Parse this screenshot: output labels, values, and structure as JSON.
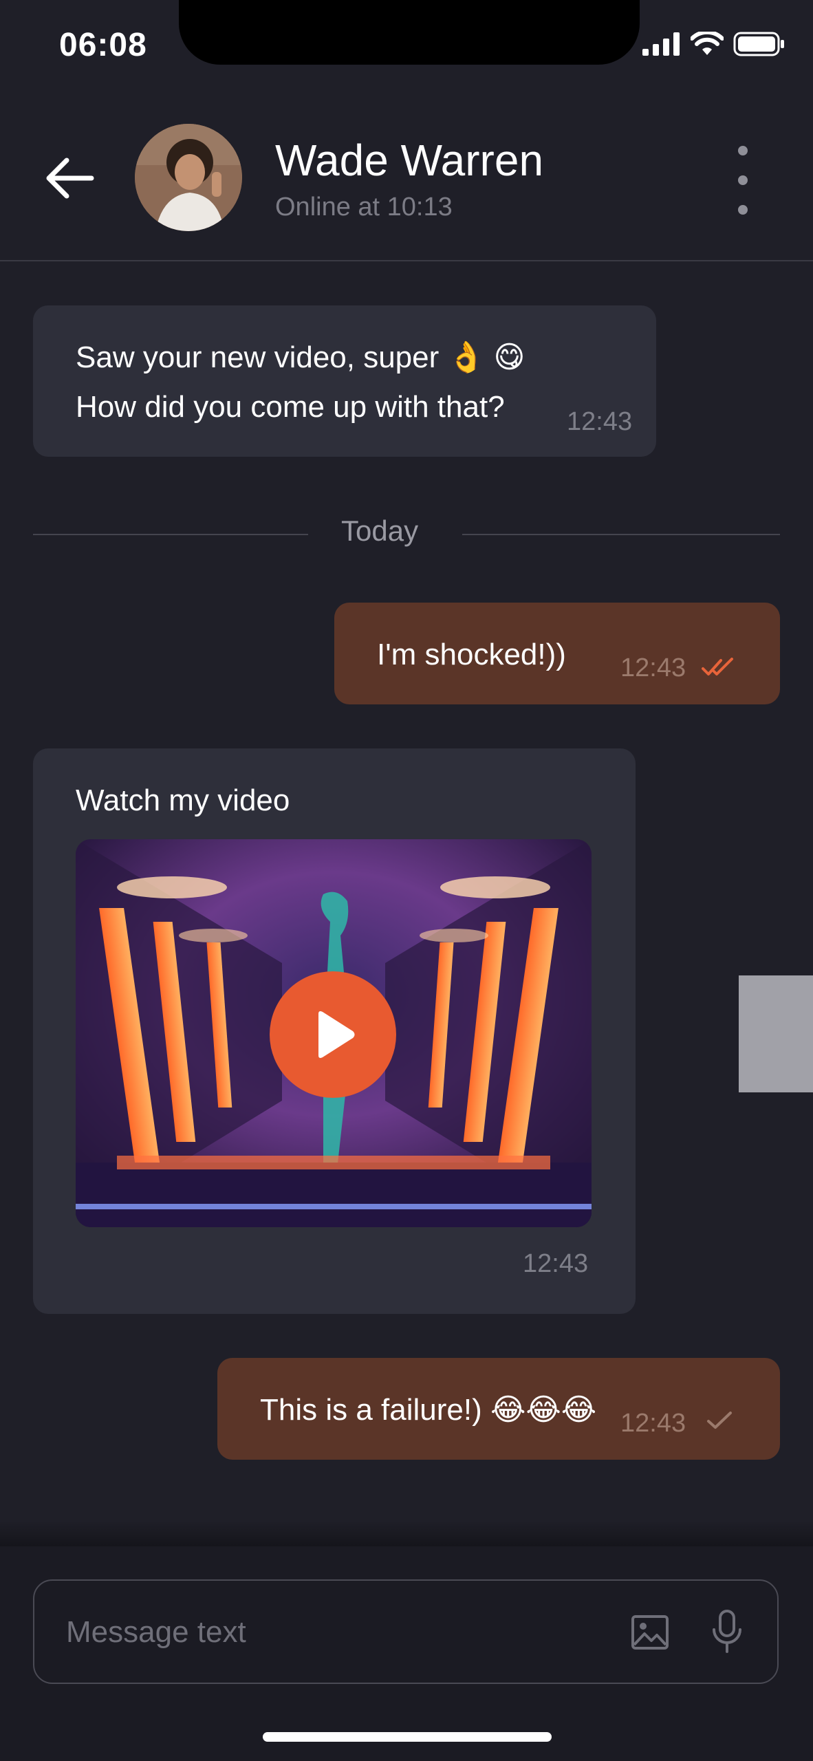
{
  "status_bar": {
    "time": "06:08"
  },
  "header": {
    "contact_name": "Wade Warren",
    "contact_status": "Online at 10:13"
  },
  "messages": [
    {
      "direction": "incoming",
      "lines": [
        "Saw your new video, super 👌 😋",
        "How did you come up with that?"
      ],
      "time": "12:43"
    },
    {
      "direction": "outgoing",
      "text": "I'm shocked!))",
      "time": "12:43",
      "status": "read"
    },
    {
      "direction": "incoming",
      "text": "Watch my video",
      "time": "12:43",
      "attachment": "video"
    },
    {
      "direction": "outgoing",
      "text": "This is a failure!) 😂😂😂",
      "time": "12:43",
      "status": "sent"
    }
  ],
  "divider": {
    "label": "Today"
  },
  "composer": {
    "placeholder": "Message text"
  },
  "colors": {
    "background": "#1f1f28",
    "incoming_bubble": "#2e2f3a",
    "outgoing_bubble": "#5b3528",
    "accent": "#e85a30"
  }
}
